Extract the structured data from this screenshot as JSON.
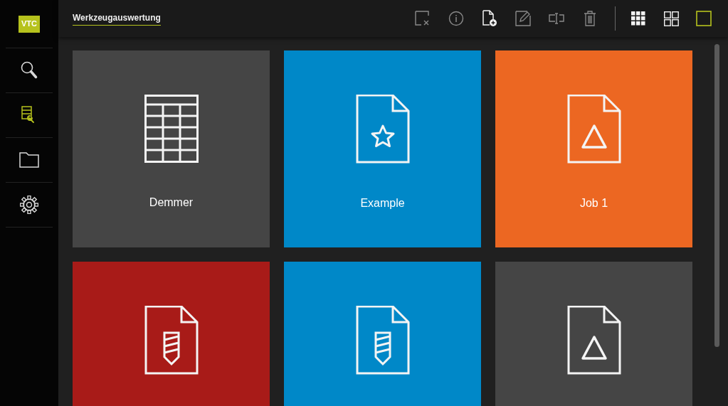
{
  "logo": {
    "text": "VTC"
  },
  "sidebar": {
    "items": [
      {
        "kind": "search",
        "selected": false
      },
      {
        "kind": "tools",
        "selected": true
      },
      {
        "kind": "folder",
        "selected": false
      },
      {
        "kind": "settings",
        "selected": false
      }
    ]
  },
  "header": {
    "title": "Werkzeugauswertung"
  },
  "toolbar": {
    "actions": [
      {
        "kind": "deselect",
        "disabled": true
      },
      {
        "kind": "info",
        "disabled": true
      },
      {
        "kind": "add",
        "disabled": false
      },
      {
        "kind": "edit",
        "disabled": true
      },
      {
        "kind": "rename",
        "disabled": true
      },
      {
        "kind": "delete",
        "disabled": true
      }
    ],
    "view_modes": [
      {
        "kind": "small",
        "selected": false
      },
      {
        "kind": "large",
        "selected": false
      },
      {
        "kind": "single",
        "selected": true
      }
    ]
  },
  "tiles": [
    {
      "kind": "table",
      "label": "Demmer",
      "color": "#454545"
    },
    {
      "kind": "star",
      "label": "Example",
      "color": "#0088c8"
    },
    {
      "kind": "triangle",
      "label": "Job 1",
      "color": "#ec6722"
    },
    {
      "kind": "drill",
      "color": "#a81b18"
    },
    {
      "kind": "drill",
      "color": "#0088c8"
    },
    {
      "kind": "triangle",
      "color": "#454545"
    }
  ]
}
